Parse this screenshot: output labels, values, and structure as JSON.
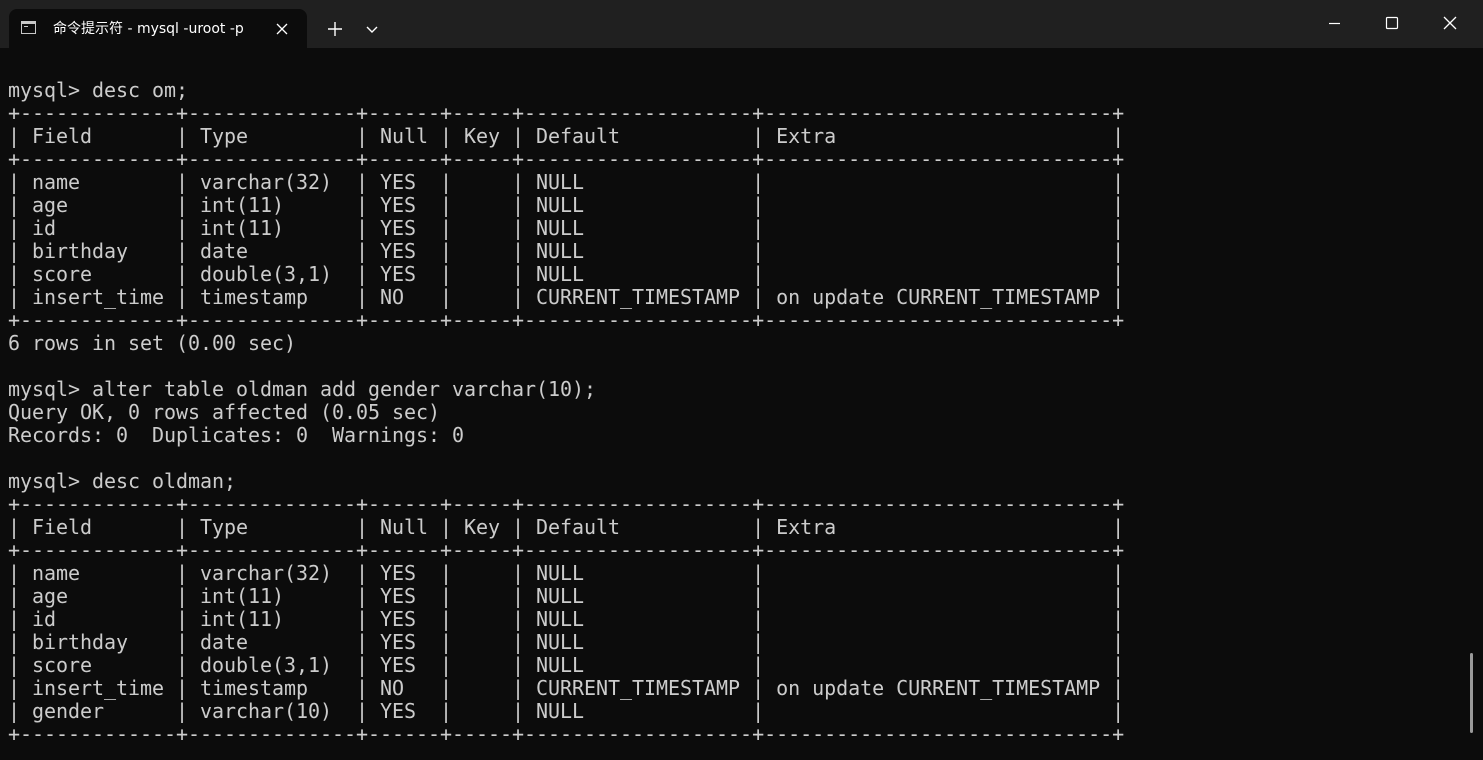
{
  "window": {
    "tab_title": "命令提示符 - mysql  -uroot -p",
    "tab_icon": "terminal-icon",
    "close_tab_icon": "close-icon",
    "new_tab_icon": "plus-icon",
    "dropdown_icon": "chevron-down-icon",
    "minimize_icon": "minimize-icon",
    "maximize_icon": "maximize-icon",
    "close_window_icon": "close-icon"
  },
  "colors": {
    "background": "#0c0c0c",
    "titlebar": "#202020",
    "text": "#cccccc"
  },
  "console": {
    "lines": [
      "mysql> desc om;",
      "+-------------+--------------+------+-----+-------------------+-----------------------------+",
      "| Field       | Type         | Null | Key | Default           | Extra                       |",
      "+-------------+--------------+------+-----+-------------------+-----------------------------+",
      "| name        | varchar(32)  | YES  |     | NULL              |                             |",
      "| age         | int(11)      | YES  |     | NULL              |                             |",
      "| id          | int(11)      | YES  |     | NULL              |                             |",
      "| birthday    | date         | YES  |     | NULL              |                             |",
      "| score       | double(3,1)  | YES  |     | NULL              |                             |",
      "| insert_time | timestamp    | NO   |     | CURRENT_TIMESTAMP | on update CURRENT_TIMESTAMP |",
      "+-------------+--------------+------+-----+-------------------+-----------------------------+",
      "6 rows in set (0.00 sec)",
      "",
      "mysql> alter table oldman add gender varchar(10);",
      "Query OK, 0 rows affected (0.05 sec)",
      "Records: 0  Duplicates: 0  Warnings: 0",
      "",
      "mysql> desc oldman;",
      "+-------------+--------------+------+-----+-------------------+-----------------------------+",
      "| Field       | Type         | Null | Key | Default           | Extra                       |",
      "+-------------+--------------+------+-----+-------------------+-----------------------------+",
      "| name        | varchar(32)  | YES  |     | NULL              |                             |",
      "| age         | int(11)      | YES  |     | NULL              |                             |",
      "| id          | int(11)      | YES  |     | NULL              |                             |",
      "| birthday    | date         | YES  |     | NULL              |                             |",
      "| score       | double(3,1)  | YES  |     | NULL              |                             |",
      "| insert_time | timestamp    | NO   |     | CURRENT_TIMESTAMP | on update CURRENT_TIMESTAMP |",
      "| gender      | varchar(10)  | YES  |     | NULL              |                             |",
      "+-------------+--------------+------+-----+-------------------+-----------------------------+"
    ]
  }
}
